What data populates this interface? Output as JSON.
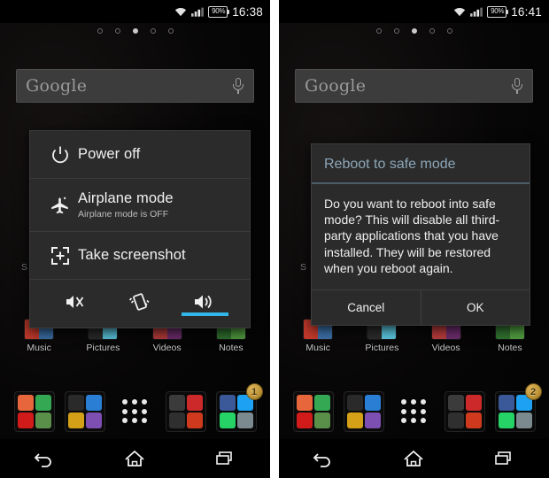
{
  "panels": [
    {
      "id": "power-menu-panel",
      "status": {
        "battery": "90%",
        "time": "16:38",
        "wifi_icon": "wifi-icon",
        "signal_icon": "signal-icon"
      },
      "page_dots": {
        "count": 5,
        "active_index": 2
      },
      "search": {
        "text": "Google",
        "mic_icon": "microphone-icon"
      },
      "widgets": [
        {
          "label": "Music",
          "colors": [
            "#c0392b",
            "#3b6ea5",
            "#101010",
            "#2b6fa8"
          ]
        },
        {
          "label": "Pictures",
          "colors": [
            "#1a1a1a",
            "#8a5a1e",
            "#2b8fb5",
            "#58c0d8"
          ]
        },
        {
          "label": "Videos",
          "colors": [
            "#b33a3a",
            "#7a2f7a",
            "#6e1f1f",
            "#401040"
          ]
        },
        {
          "label": "Notes",
          "colors": [
            "#2f6f2f",
            "#4f9a3e",
            "#1c4a1c",
            "#3e7a32"
          ]
        }
      ],
      "dock": [
        {
          "name": "browsers-folder",
          "icon": "folder-icon",
          "tiles": [
            "#e8663b",
            "#34a853",
            "#d11a1a",
            "#5a8f4a"
          ]
        },
        {
          "name": "phone-folder",
          "icon": "folder-icon",
          "tiles": [
            "#2a2a2a",
            "#2a7fd4",
            "#d4a017",
            "#7d4fb3"
          ]
        },
        {
          "name": "app-drawer",
          "icon": "app-drawer-icon",
          "tiles": []
        },
        {
          "name": "media-folder",
          "icon": "folder-icon",
          "tiles": [
            "#3b3b3b",
            "#cc2a2a",
            "#2f2f2f",
            "#cf3a1f"
          ]
        },
        {
          "name": "social-folder",
          "icon": "folder-icon",
          "tiles": [
            "#3b5998",
            "#1da1f2",
            "#25d366",
            "#7a8a8f"
          ],
          "badge": "1"
        }
      ],
      "navigation": [
        {
          "name": "back-button",
          "icon": "back-arrow-icon"
        },
        {
          "name": "home-button",
          "icon": "home-icon"
        },
        {
          "name": "recents-button",
          "icon": "recents-icon"
        }
      ],
      "power_menu": {
        "items": [
          {
            "icon": "power-icon",
            "title": "Power off",
            "subtitle": ""
          },
          {
            "icon": "airplane-icon",
            "title": "Airplane mode",
            "subtitle": "Airplane mode is OFF"
          },
          {
            "icon": "screenshot-icon",
            "title": "Take screenshot",
            "subtitle": ""
          }
        ],
        "sound_modes": [
          {
            "name": "silent-mode-button",
            "icon": "mute-icon",
            "selected": false
          },
          {
            "name": "vibrate-mode-button",
            "icon": "vibrate-icon",
            "selected": false
          },
          {
            "name": "sound-mode-button",
            "icon": "speaker-icon",
            "selected": true
          }
        ],
        "selected_accent": "#31b6e7"
      }
    },
    {
      "id": "reboot-dialog-panel",
      "status": {
        "battery": "90%",
        "time": "16:41",
        "wifi_icon": "wifi-icon",
        "signal_icon": "signal-icon"
      },
      "page_dots": {
        "count": 5,
        "active_index": 2
      },
      "search": {
        "text": "Google",
        "mic_icon": "microphone-icon"
      },
      "widgets": [
        {
          "label": "Music",
          "colors": [
            "#c0392b",
            "#3b6ea5",
            "#101010",
            "#2b6fa8"
          ]
        },
        {
          "label": "Pictures",
          "colors": [
            "#1a1a1a",
            "#8a5a1e",
            "#2b8fb5",
            "#58c0d8"
          ]
        },
        {
          "label": "Videos",
          "colors": [
            "#b33a3a",
            "#7a2f7a",
            "#6e1f1f",
            "#401040"
          ]
        },
        {
          "label": "Notes",
          "colors": [
            "#2f6f2f",
            "#4f9a3e",
            "#1c4a1c",
            "#3e7a32"
          ]
        }
      ],
      "dock": [
        {
          "name": "browsers-folder",
          "icon": "folder-icon",
          "tiles": [
            "#e8663b",
            "#34a853",
            "#d11a1a",
            "#5a8f4a"
          ]
        },
        {
          "name": "phone-folder",
          "icon": "folder-icon",
          "tiles": [
            "#2a2a2a",
            "#2a7fd4",
            "#d4a017",
            "#7d4fb3"
          ]
        },
        {
          "name": "app-drawer",
          "icon": "app-drawer-icon",
          "tiles": []
        },
        {
          "name": "media-folder",
          "icon": "folder-icon",
          "tiles": [
            "#3b3b3b",
            "#cc2a2a",
            "#2f2f2f",
            "#cf3a1f"
          ]
        },
        {
          "name": "social-folder",
          "icon": "folder-icon",
          "tiles": [
            "#3b5998",
            "#1da1f2",
            "#25d366",
            "#7a8a8f"
          ],
          "badge": "2"
        }
      ],
      "navigation": [
        {
          "name": "back-button",
          "icon": "back-arrow-icon"
        },
        {
          "name": "home-button",
          "icon": "home-icon"
        },
        {
          "name": "recents-button",
          "icon": "recents-icon"
        }
      ],
      "dialog": {
        "title": "Reboot to safe mode",
        "title_color": "#8ca6b8",
        "message": "Do you want to reboot into safe mode? This will disable all third-party applications that you have installed. They will be restored when you reboot again.",
        "buttons": [
          {
            "name": "cancel-button",
            "label": "Cancel"
          },
          {
            "name": "ok-button",
            "label": "OK"
          }
        ]
      }
    }
  ]
}
